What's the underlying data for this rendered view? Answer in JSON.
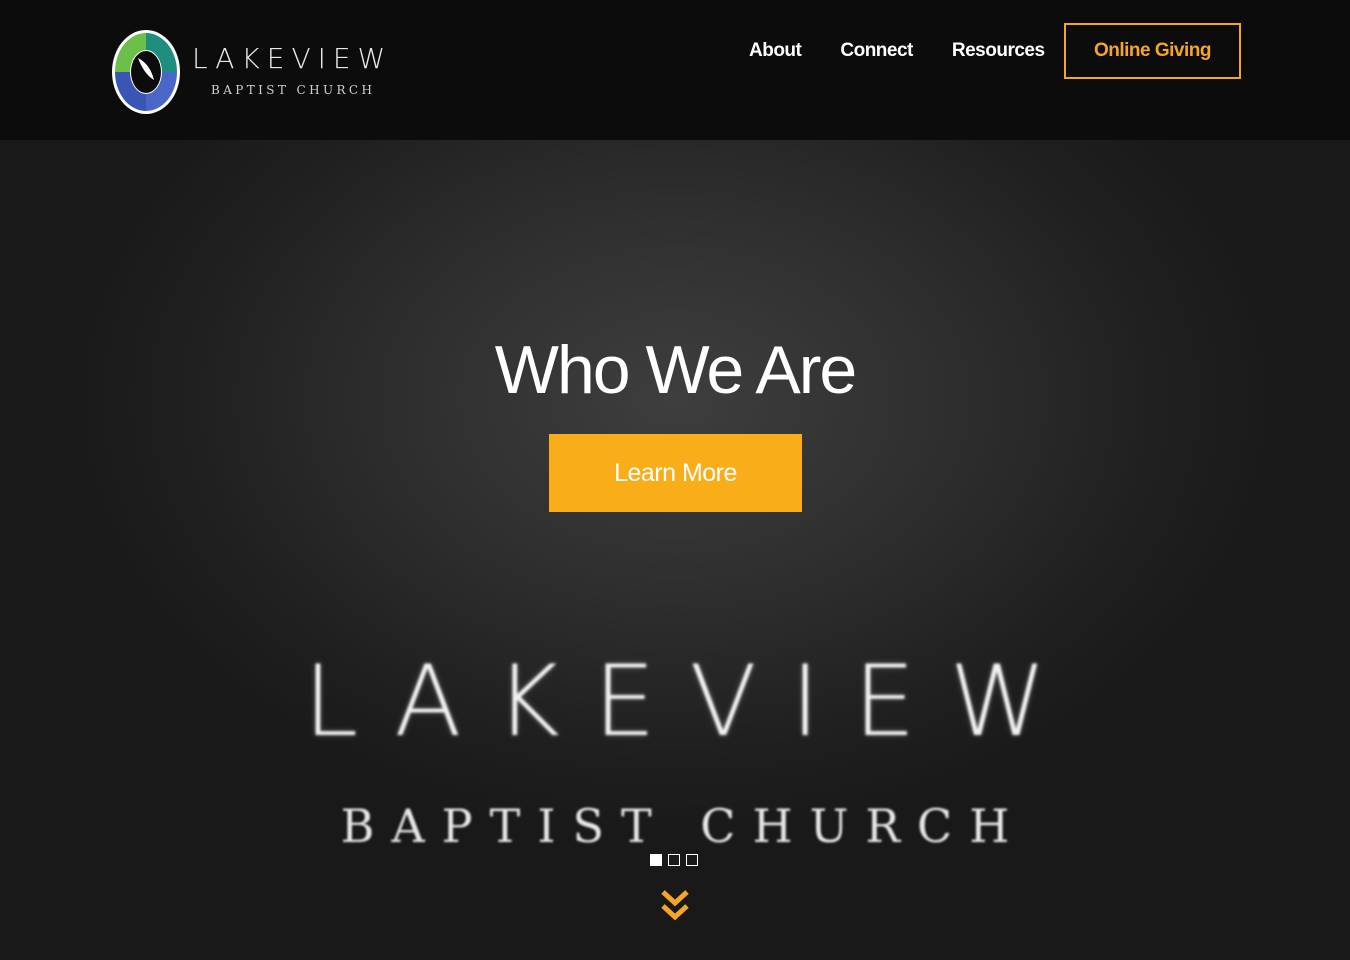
{
  "header": {
    "logo": {
      "name": "LAKEVIEW",
      "subtitle": "BAPTIST CHURCH",
      "colors": {
        "green": "#6cc04a",
        "blue": "#3a56b4",
        "teal": "#1e8e7e"
      }
    },
    "nav": [
      {
        "label": "About"
      },
      {
        "label": "Connect"
      },
      {
        "label": "Resources"
      }
    ],
    "giving_label": "Online Giving",
    "accent": "#f5a623"
  },
  "hero": {
    "title": "Who We Are",
    "cta_label": "Learn More",
    "cta_color": "#f9ad19",
    "image_text": {
      "name": "LAKEVIEW",
      "subtitle": "BAPTIST CHURCH"
    },
    "slides": {
      "count": 3,
      "active": 1
    },
    "scroll_icon": "double-chevron-down-icon"
  }
}
